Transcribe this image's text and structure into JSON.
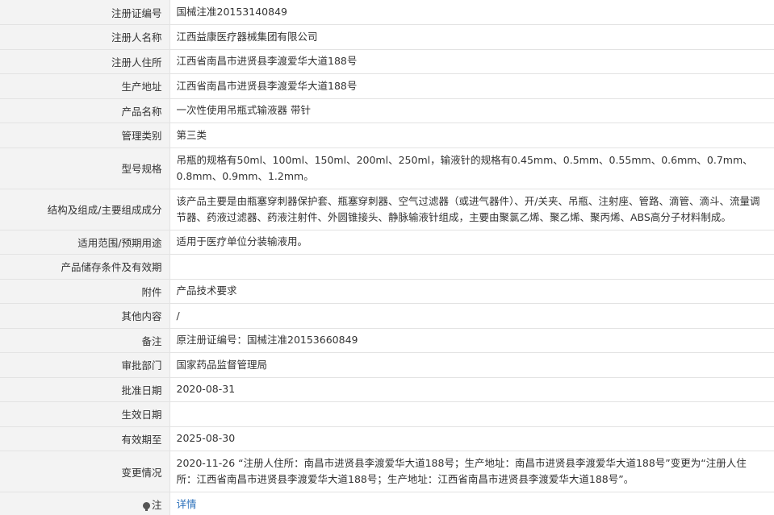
{
  "rows": [
    {
      "label": "注册证编号",
      "value": "国械注准20153140849"
    },
    {
      "label": "注册人名称",
      "value": "江西益康医疗器械集团有限公司"
    },
    {
      "label": "注册人住所",
      "value": "江西省南昌市进贤县李渡爱华大道188号"
    },
    {
      "label": "生产地址",
      "value": "江西省南昌市进贤县李渡爱华大道188号"
    },
    {
      "label": "产品名称",
      "value": "一次性使用吊瓶式输液器 带针"
    },
    {
      "label": "管理类别",
      "value": "第三类"
    },
    {
      "label": "型号规格",
      "value": "吊瓶的规格有50ml、100ml、150ml、200ml、250ml，输液针的规格有0.45mm、0.5mm、0.55mm、0.6mm、0.7mm、0.8mm、0.9mm、1.2mm。"
    },
    {
      "label": "结构及组成/主要组成成分",
      "value": "该产品主要是由瓶塞穿刺器保护套、瓶塞穿刺器、空气过滤器（或进气器件）、开/关夹、吊瓶、注射座、管路、滴管、滴斗、流量调节器、药液过滤器、药液注射件、外圆锥接头、静脉输液针组成，主要由聚氯乙烯、聚乙烯、聚丙烯、ABS高分子材料制成。"
    },
    {
      "label": "适用范围/预期用途",
      "value": "适用于医疗单位分装输液用。"
    },
    {
      "label": "产品储存条件及有效期",
      "value": ""
    },
    {
      "label": "附件",
      "value": "产品技术要求"
    },
    {
      "label": "其他内容",
      "value": "/"
    },
    {
      "label": "备注",
      "value": "原注册证编号：国械注准20153660849"
    },
    {
      "label": "审批部门",
      "value": "国家药品监督管理局"
    },
    {
      "label": "批准日期",
      "value": "2020-08-31"
    },
    {
      "label": "生效日期",
      "value": ""
    },
    {
      "label": "有效期至",
      "value": "2025-08-30"
    },
    {
      "label": "变更情况",
      "value": "2020-11-26 “注册人住所：南昌市进贤县李渡爱华大道188号；生产地址：南昌市进贤县李渡爱华大道188号”变更为“注册人住所：江西省南昌市进贤县李渡爱华大道188号；生产地址：江西省南昌市进贤县李渡爱华大道188号”。"
    }
  ],
  "note": {
    "label": "注",
    "link_text": "详情",
    "icon": "lightbulb-icon"
  },
  "colors": {
    "label_bg": "#f3f3f3",
    "border": "#e3e3e3",
    "link": "#2a6fba"
  }
}
